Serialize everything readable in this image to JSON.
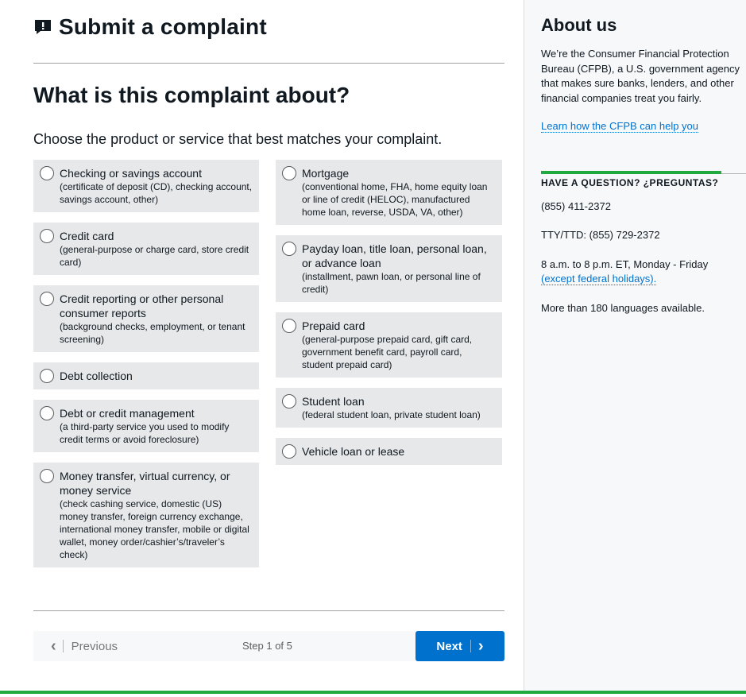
{
  "header": {
    "title": "Submit a complaint",
    "icon": "alert-comment-icon"
  },
  "question": "What is this complaint about?",
  "instruction": "Choose the product or service that best matches your complaint.",
  "options_left": [
    {
      "label": "Checking or savings account",
      "desc": "(certificate of deposit (CD), checking account, savings account, other)"
    },
    {
      "label": "Credit card",
      "desc": "(general-purpose or charge card, store credit card)"
    },
    {
      "label": "Credit reporting or other personal consumer reports",
      "desc": "(background checks, employment, or tenant screening)"
    },
    {
      "label": "Debt collection",
      "desc": ""
    },
    {
      "label": "Debt or credit management",
      "desc": "(a third-party service you used to modify credit terms or avoid foreclosure)"
    },
    {
      "label": "Money transfer, virtual currency, or money service",
      "desc": "(check cashing service, domestic (US) money transfer, foreign currency exchange, international money transfer, mobile or digital wallet, money order/cashier’s/traveler’s check)"
    }
  ],
  "options_right": [
    {
      "label": "Mortgage",
      "desc": "(conventional home, FHA, home equity loan or line of credit (HELOC), manufactured home loan, reverse, USDA, VA, other)"
    },
    {
      "label": "Payday loan, title loan, personal loan, or advance loan",
      "desc": "(installment, pawn loan, or personal line of credit)"
    },
    {
      "label": "Prepaid card",
      "desc": "(general-purpose prepaid card, gift card, government benefit card, payroll card, student prepaid card)"
    },
    {
      "label": "Student loan",
      "desc": "(federal student loan, private student loan)"
    },
    {
      "label": "Vehicle loan or lease",
      "desc": ""
    }
  ],
  "nav": {
    "previous": "Previous",
    "step": "Step 1 of 5",
    "next": "Next"
  },
  "sidebar": {
    "about_heading": "About us",
    "about_text": "We’re the Consumer Financial Protection Bureau (CFPB), a U.S. government agency that makes sure banks, lenders, and other financial companies treat you fairly.",
    "about_link": "Learn how the CFPB can help you",
    "question_heading": "HAVE A QUESTION? ¿PREGUNTAS?",
    "phone": "(855) 411-2372",
    "tty": "TTY/TTD: (855) 729-2372",
    "hours": "8 a.m. to 8 p.m. ET, Monday - Friday",
    "holidays_link": "(except federal holidays).",
    "languages": "More than 180 languages available."
  },
  "colors": {
    "accent": "#0072ce",
    "green": "#20aa3f",
    "option_bg": "#e7e8e9"
  }
}
